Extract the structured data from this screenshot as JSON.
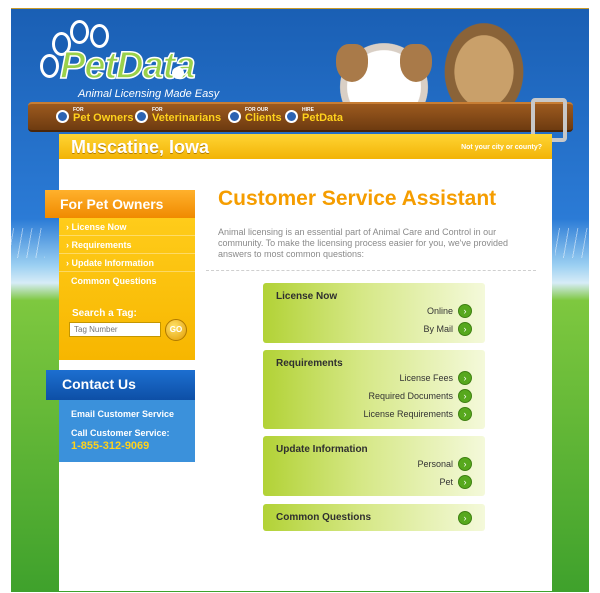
{
  "brand": {
    "name": "PetData",
    "tagline": "Animal Licensing Made Easy"
  },
  "top_nav": [
    {
      "small": "FOR",
      "label": "Pet Owners"
    },
    {
      "small": "FOR",
      "label": "Veterinarians"
    },
    {
      "small": "FOR OUR",
      "label": "Clients"
    },
    {
      "small": "HIRE",
      "label": "PetData"
    }
  ],
  "location": {
    "city": "Muscatine, Iowa",
    "change_link": "Not your city or county?"
  },
  "sidebar": {
    "title": "For Pet Owners",
    "items": [
      {
        "label": "› License Now"
      },
      {
        "label": "› Requirements"
      },
      {
        "label": "› Update Information"
      },
      {
        "label": "Common Questions"
      }
    ],
    "search": {
      "label": "Search a Tag:",
      "placeholder": "Tag Number",
      "button": "GO"
    }
  },
  "contact": {
    "title": "Contact Us",
    "email_label": "Email Customer Service",
    "call_label": "Call Customer Service:",
    "phone": "1-855-312-9069"
  },
  "main": {
    "title": "Customer Service Assistant",
    "intro": "Animal licensing is an essential part of Animal Care and Control in our community. To make the licensing process easier for you, we've provided answers to most common questions:",
    "cards": [
      {
        "title": "License Now",
        "links": [
          "Online",
          "By Mail"
        ]
      },
      {
        "title": "Requirements",
        "links": [
          "License Fees",
          "Required Documents",
          "License Requirements"
        ]
      },
      {
        "title": "Update Information",
        "links": [
          "Personal",
          "Pet"
        ]
      },
      {
        "title": "Common Questions",
        "links": []
      }
    ]
  },
  "colors": {
    "accent_orange": "#f59d00",
    "link_green": "#57a81d",
    "header_blue": "#1a5fb4",
    "city_yellow": "#ffd534"
  },
  "icons": {
    "go_arrow": "arrow-right-circle-icon"
  }
}
